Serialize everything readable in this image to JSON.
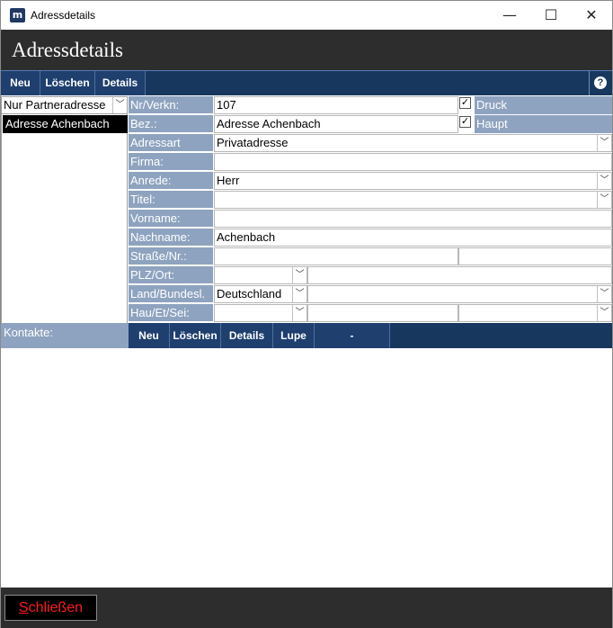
{
  "window": {
    "title": "Adressdetails",
    "icon_text": "m",
    "minimize": "—",
    "maximize": "☐",
    "close": "✕"
  },
  "header": {
    "title": "Adressdetails"
  },
  "toolbar": {
    "neu": "Neu",
    "loeschen": "Löschen",
    "details": "Details",
    "help": "?"
  },
  "left": {
    "filter_value": "Nur Partneradresse",
    "items": [
      {
        "label": "Adresse Achenbach"
      }
    ]
  },
  "form": {
    "nr_label": "Nr/Verkn:",
    "nr_value": "107",
    "bez_label": "Bez.:",
    "bez_value": "Adresse Achenbach",
    "druck_label": "Druck",
    "haupt_label": "Haupt",
    "adressart_label": "Adressart",
    "adressart_value": "Privatadresse",
    "firma_label": "Firma:",
    "firma_value": "",
    "anrede_label": "Anrede:",
    "anrede_value": "Herr",
    "titel_label": "Titel:",
    "titel_value": "",
    "vorname_label": "Vorname:",
    "vorname_value": "",
    "nachname_label": "Nachname:",
    "nachname_value": "Achenbach",
    "strasse_label": "Straße/Nr.:",
    "strasse_value": "",
    "hausnr_value": "",
    "plz_label": "PLZ/Ort:",
    "plz_value": "",
    "ort_value": "",
    "land_label": "Land/Bundesl.",
    "land_value": "Deutschland",
    "bundesland_value": "",
    "hau_label": "Hau/Et/Sei:",
    "hau_value": "",
    "et_value": "",
    "sei_value": "",
    "check_mark": "✓"
  },
  "contacts": {
    "label": "Kontakte:",
    "neu": "Neu",
    "loeschen": "Löschen",
    "details": "Details",
    "lupe": "Lupe",
    "dash": "-"
  },
  "footer": {
    "close_first": "S",
    "close_rest": "chließen"
  },
  "colors": {
    "header_bg": "#2d2d2d",
    "toolbar_bg": "#17375e",
    "label_bg": "#8ea3bf",
    "close_text": "#ff1a1a"
  }
}
